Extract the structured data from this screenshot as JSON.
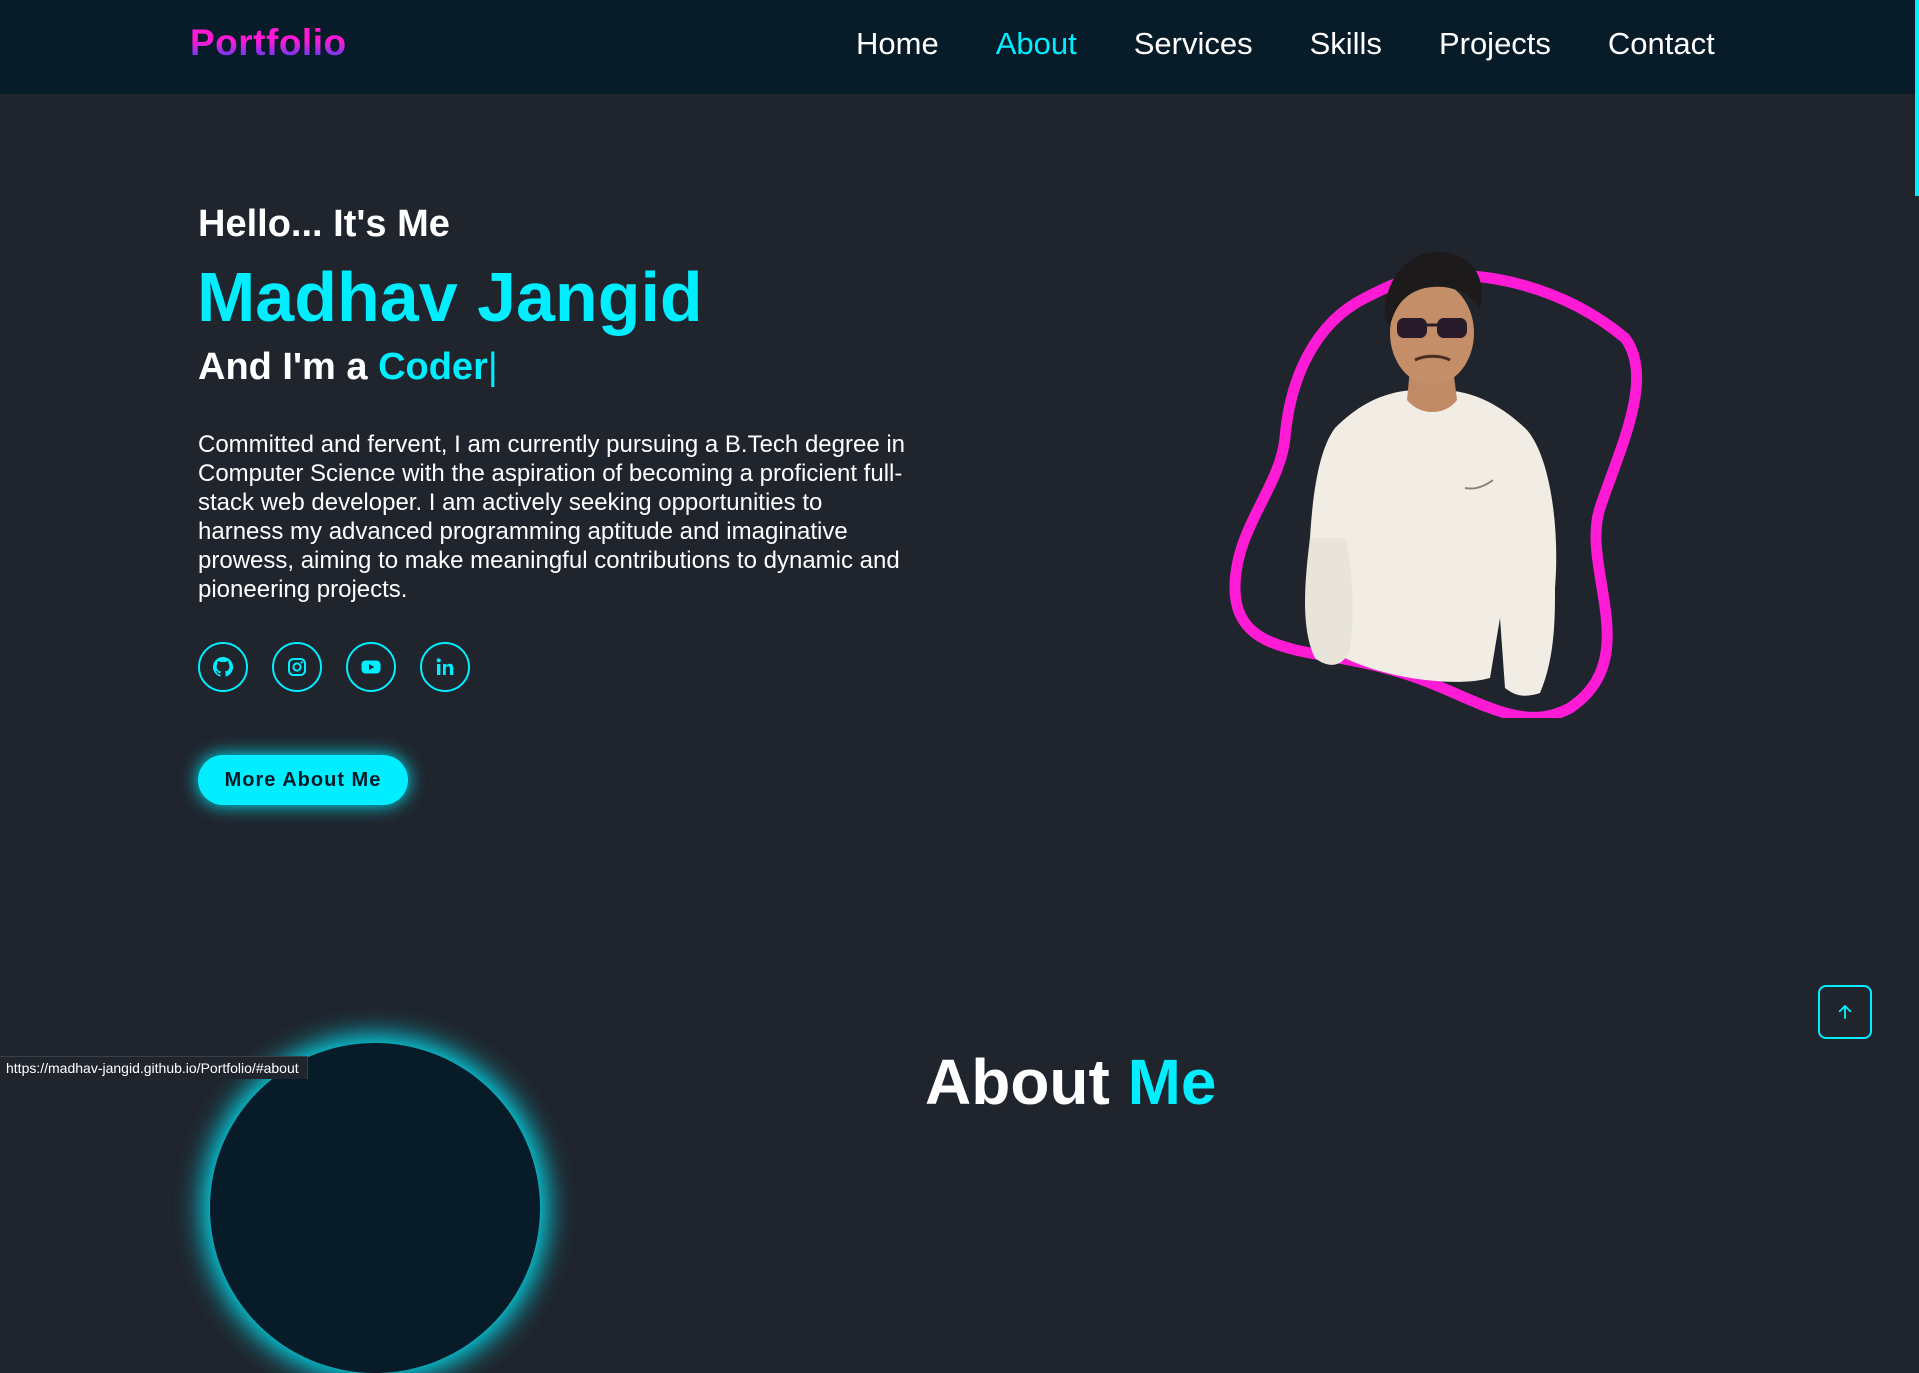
{
  "header": {
    "logo": "Portfolio",
    "nav": [
      {
        "label": "Home",
        "active": false
      },
      {
        "label": "About",
        "active": true
      },
      {
        "label": "Services",
        "active": false
      },
      {
        "label": "Skills",
        "active": false
      },
      {
        "label": "Projects",
        "active": false
      },
      {
        "label": "Contact",
        "active": false
      }
    ]
  },
  "hero": {
    "greeting": "Hello... It's Me",
    "name": "Madhav Jangid",
    "role_prefix": "And I'm a",
    "role_typed": "Coder",
    "role_cursor": "|",
    "bio": "Committed and fervent, I am currently pursuing a B.Tech degree in Computer Science with the aspiration of becoming a proficient full-stack web developer. I am actively seeking opportunities to harness my advanced programming aptitude and imaginative prowess, aiming to make meaningful contributions to dynamic and pioneering projects.",
    "socials": [
      {
        "icon": "github-icon"
      },
      {
        "icon": "instagram-icon"
      },
      {
        "icon": "youtube-icon"
      },
      {
        "icon": "linkedin-icon"
      }
    ],
    "button_label": "More About Me"
  },
  "about_section": {
    "heading_prefix": "About",
    "heading_accent": "Me"
  },
  "status_bar": {
    "url": "https://madhav-jangid.github.io/Portfolio/#about"
  },
  "colors": {
    "accent": "#00eeff",
    "background": "#1f242d",
    "header_bg": "#081b29",
    "blob_stroke": "#ff1bd6"
  }
}
